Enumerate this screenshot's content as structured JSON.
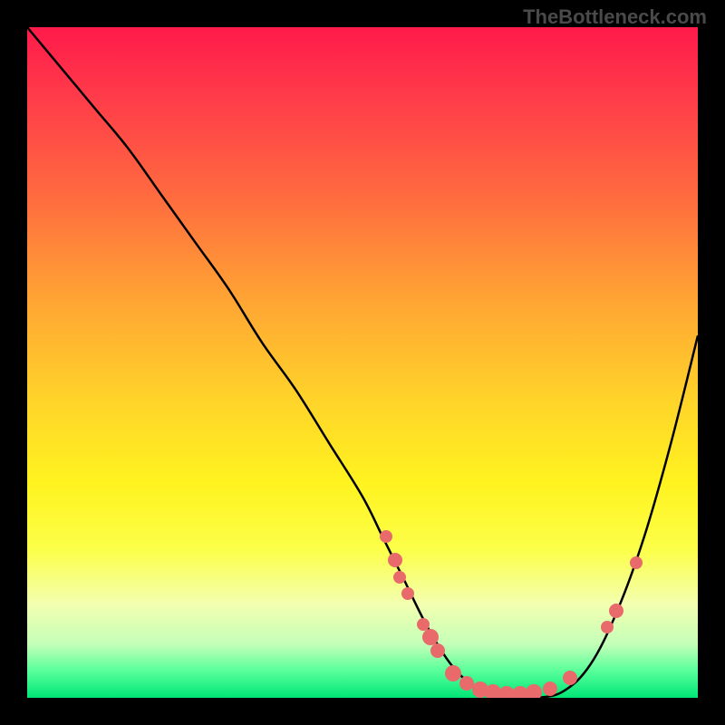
{
  "watermark": "TheBottleneck.com",
  "colors": {
    "point_fill": "#e86a6a",
    "curve_stroke": "#000000",
    "background": "#000000"
  },
  "chart_data": {
    "type": "line",
    "title": "",
    "xlabel": "",
    "ylabel": "",
    "xlim": [
      0,
      100
    ],
    "ylim": [
      0,
      100
    ],
    "grid": false,
    "description": "Bottleneck curve with colored gradient background (red=high bottleneck, green=low). Curve dips to a flat minimum around x≈62-80 then rises.",
    "series": [
      {
        "name": "bottleneck-curve",
        "x": [
          0,
          5,
          10,
          15,
          20,
          25,
          30,
          35,
          40,
          45,
          50,
          53,
          56,
          60,
          64,
          68,
          72,
          76,
          80,
          84,
          88,
          92,
          96,
          100
        ],
        "y": [
          100,
          94,
          88,
          82,
          75,
          68,
          61,
          53,
          46,
          38,
          30,
          24,
          18,
          10,
          4,
          1,
          0,
          0,
          1,
          5,
          13,
          24,
          38,
          54
        ]
      }
    ],
    "points": [
      {
        "x": 53.5,
        "y": 24.0,
        "r": 7
      },
      {
        "x": 54.8,
        "y": 20.5,
        "r": 8
      },
      {
        "x": 55.6,
        "y": 18.0,
        "r": 7
      },
      {
        "x": 56.7,
        "y": 15.5,
        "r": 7
      },
      {
        "x": 59.0,
        "y": 11.0,
        "r": 7
      },
      {
        "x": 60.2,
        "y": 9.0,
        "r": 9
      },
      {
        "x": 61.2,
        "y": 7.0,
        "r": 8
      },
      {
        "x": 63.5,
        "y": 3.6,
        "r": 9
      },
      {
        "x": 65.5,
        "y": 2.2,
        "r": 8
      },
      {
        "x": 67.5,
        "y": 1.2,
        "r": 9
      },
      {
        "x": 69.5,
        "y": 0.8,
        "r": 9
      },
      {
        "x": 71.5,
        "y": 0.6,
        "r": 9
      },
      {
        "x": 73.5,
        "y": 0.6,
        "r": 9
      },
      {
        "x": 75.5,
        "y": 0.8,
        "r": 9
      },
      {
        "x": 78.0,
        "y": 1.4,
        "r": 8
      },
      {
        "x": 81.0,
        "y": 3.0,
        "r": 8
      },
      {
        "x": 86.5,
        "y": 10.5,
        "r": 7
      },
      {
        "x": 87.8,
        "y": 13.0,
        "r": 8
      },
      {
        "x": 90.8,
        "y": 20.2,
        "r": 7
      }
    ]
  }
}
